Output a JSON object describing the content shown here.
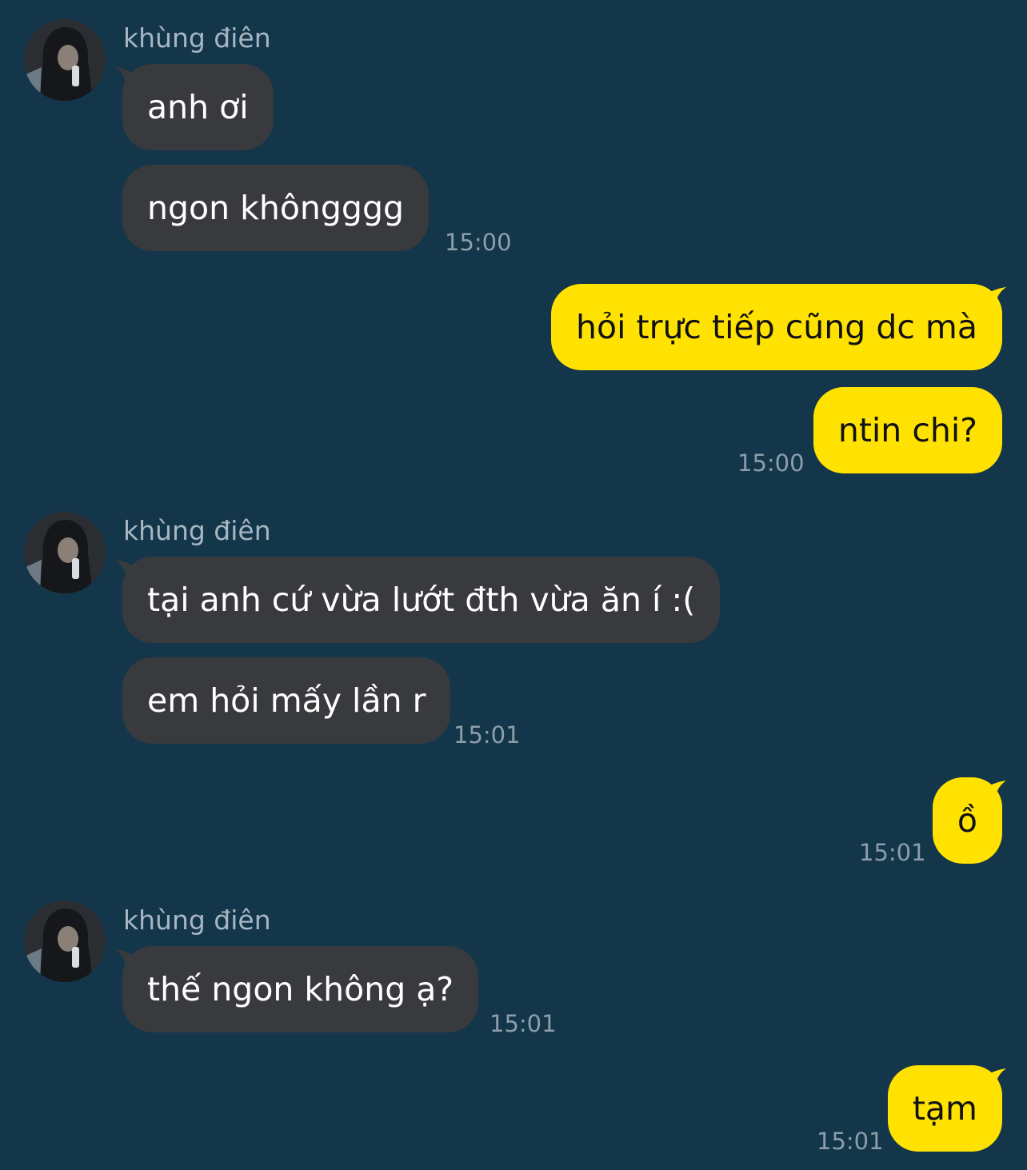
{
  "contact": {
    "name": "khùng điên"
  },
  "messages": [
    {
      "text": "anh ơi"
    },
    {
      "text": "ngon khôngggg"
    },
    {
      "text": "hỏi trực tiếp cũng dc mà"
    },
    {
      "text": "ntin chi?"
    },
    {
      "text": "tại anh cứ vừa lướt đth vừa ăn í :("
    },
    {
      "text": "em hỏi mấy lần r"
    },
    {
      "text": "ồ"
    },
    {
      "text": "thế ngon không ạ?"
    },
    {
      "text": "tạm"
    }
  ],
  "timestamps": [
    "15:00",
    "15:00",
    "15:01",
    "15:01",
    "15:01",
    "15:01"
  ],
  "colors": {
    "background": "#13364a",
    "incoming_bubble": "#383a3e",
    "outgoing_bubble": "#ffe201",
    "timestamp": "#8d9eab",
    "sender_name": "#a7b6c2"
  }
}
